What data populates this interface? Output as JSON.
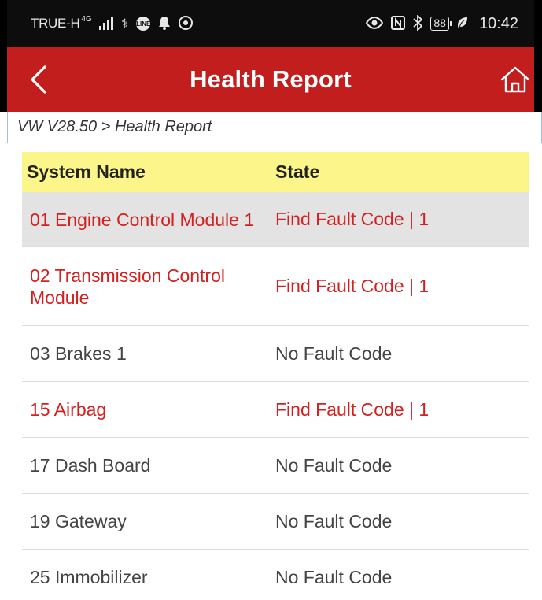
{
  "status_bar": {
    "carrier": "TRUE-H",
    "network": "4G⁺",
    "battery": "88",
    "time": "10:42"
  },
  "app_bar": {
    "title": "Health Report"
  },
  "breadcrumb": "VW V28.50 > Health Report",
  "table": {
    "headers": {
      "name": "System Name",
      "state": "State"
    },
    "rows": [
      {
        "name": "01 Engine Control Module 1",
        "state": "Find Fault Code | 1"
      },
      {
        "name": "02 Transmission Control Module",
        "state": "Find Fault Code | 1"
      },
      {
        "name": "03 Brakes 1",
        "state": "No Fault Code"
      },
      {
        "name": "15 Airbag",
        "state": "Find Fault Code | 1"
      },
      {
        "name": "17 Dash Board",
        "state": "No Fault Code"
      },
      {
        "name": "19 Gateway",
        "state": "No Fault Code"
      },
      {
        "name": "25 Immobilizer",
        "state": "No Fault Code"
      }
    ]
  },
  "colors": {
    "app_bar": "#c21e1e",
    "header_row": "#fcf589",
    "fault_text": "#d32020"
  }
}
